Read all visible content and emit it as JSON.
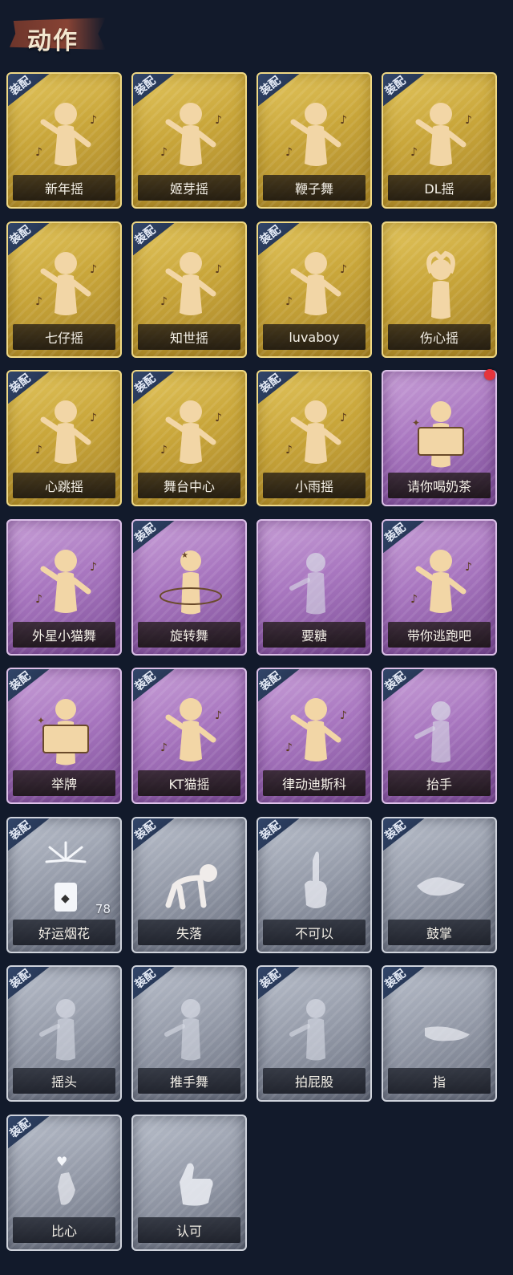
{
  "header": {
    "title": "动作"
  },
  "equip_label": "装配",
  "colors": {
    "gold": "#c9a63a",
    "purple": "#a977c0",
    "gray": "#949aa8",
    "badge": "#1e2c47",
    "notify_dot": "#e5343c"
  },
  "cards": [
    {
      "label": "新年摇",
      "rarity": "gold",
      "equipped": true,
      "icon": "dance-figure-icon"
    },
    {
      "label": "姬芽摇",
      "rarity": "gold",
      "equipped": true,
      "icon": "dance-figure-icon"
    },
    {
      "label": "鞭子舞",
      "rarity": "gold",
      "equipped": true,
      "icon": "dance-figure-icon"
    },
    {
      "label": "DL摇",
      "rarity": "gold",
      "equipped": true,
      "icon": "dance-figure-icon"
    },
    {
      "label": "七仔摇",
      "rarity": "gold",
      "equipped": true,
      "icon": "dance-figure-icon"
    },
    {
      "label": "知世摇",
      "rarity": "gold",
      "equipped": true,
      "icon": "dance-figure-icon"
    },
    {
      "label": "luvaboy",
      "rarity": "gold",
      "equipped": true,
      "icon": "dance-figure-icon"
    },
    {
      "label": "伤心摇",
      "rarity": "gold",
      "equipped": false,
      "icon": "heart-hands-figure-icon"
    },
    {
      "label": "心跳摇",
      "rarity": "gold",
      "equipped": true,
      "icon": "dance-figure-icon"
    },
    {
      "label": "舞台中心",
      "rarity": "gold",
      "equipped": true,
      "icon": "dance-figure-icon"
    },
    {
      "label": "小雨摇",
      "rarity": "gold",
      "equipped": true,
      "icon": "dance-figure-icon"
    },
    {
      "label": "请你喝奶茶",
      "rarity": "purple",
      "equipped": false,
      "icon": "sign-figure-icon"
    },
    {
      "label": "外星小猫舞",
      "rarity": "purple",
      "equipped": false,
      "icon": "dance-figure-icon"
    },
    {
      "label": "旋转舞",
      "rarity": "purple",
      "equipped": true,
      "icon": "spin-figure-icon"
    },
    {
      "label": "要糖",
      "rarity": "purple",
      "equipped": false,
      "icon": "ghost-figure-icon"
    },
    {
      "label": "带你逃跑吧",
      "rarity": "purple",
      "equipped": true,
      "icon": "dance-figure-icon"
    },
    {
      "label": "举牌",
      "rarity": "purple",
      "equipped": true,
      "icon": "sign-figure-icon"
    },
    {
      "label": "KT猫摇",
      "rarity": "purple",
      "equipped": true,
      "icon": "dance-figure-icon"
    },
    {
      "label": "律动迪斯科",
      "rarity": "purple",
      "equipped": true,
      "icon": "dance-figure-icon"
    },
    {
      "label": "抬手",
      "rarity": "purple",
      "equipped": true,
      "icon": "ghost-figure-icon"
    },
    {
      "label": "好运烟花",
      "rarity": "gray",
      "equipped": true,
      "icon": "firework-icon",
      "count": "78"
    },
    {
      "label": "失落",
      "rarity": "gray",
      "equipped": true,
      "icon": "crawl-figure-icon"
    },
    {
      "label": "不可以",
      "rarity": "gray",
      "equipped": true,
      "icon": "finger-wag-icon"
    },
    {
      "label": "鼓掌",
      "rarity": "gray",
      "equipped": true,
      "icon": "clap-hands-icon"
    },
    {
      "label": "摇头",
      "rarity": "gray",
      "equipped": true,
      "icon": "ghost-figure-icon"
    },
    {
      "label": "推手舞",
      "rarity": "gray",
      "equipped": true,
      "icon": "ghost-figure-icon"
    },
    {
      "label": "拍屁股",
      "rarity": "gray",
      "equipped": true,
      "icon": "ghost-figure-icon"
    },
    {
      "label": "指",
      "rarity": "gray",
      "equipped": true,
      "icon": "point-hand-icon"
    },
    {
      "label": "比心",
      "rarity": "gray",
      "equipped": true,
      "icon": "finger-heart-icon"
    },
    {
      "label": "认可",
      "rarity": "gray",
      "equipped": false,
      "icon": "thumbs-up-icon"
    }
  ],
  "notification": {
    "card_index": 11
  }
}
